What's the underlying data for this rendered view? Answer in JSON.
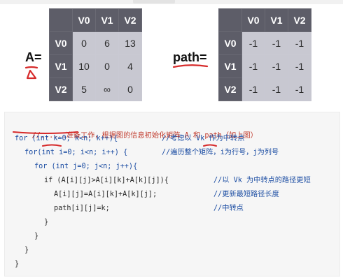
{
  "matrix_a": {
    "label": "A=",
    "columns": [
      "V0",
      "V1",
      "V2"
    ],
    "rows": [
      {
        "header": "V0",
        "cells": [
          "0",
          "6",
          "13"
        ]
      },
      {
        "header": "V1",
        "cells": [
          "10",
          "0",
          "4"
        ]
      },
      {
        "header": "V2",
        "cells": [
          "5",
          "∞",
          "0"
        ]
      }
    ]
  },
  "matrix_path": {
    "label": "path=",
    "columns": [
      "V0",
      "V1",
      "V2"
    ],
    "rows": [
      {
        "header": "V0",
        "cells": [
          "-1",
          "-1",
          "-1"
        ]
      },
      {
        "header": "V1",
        "cells": [
          "-1",
          "-1",
          "-1"
        ]
      },
      {
        "header": "V2",
        "cells": [
          "-1",
          "-1",
          "-1"
        ]
      }
    ]
  },
  "code": {
    "line1": "//......准备工作，根据图的信息初始化矩阵 A 和 path（如上图）",
    "line2_code": "for (int k=0; k<n; k++){",
    "line2_comment": "//考虑以 Vk 作为中转点",
    "line3_code": "for(int i=0; i<n; i++) {",
    "line3_comment": "//遍历整个矩阵，i为行号，j为列号",
    "line4_code": "for (int j=0; j<n; j++){",
    "line5_code": "if (A[i][j]>A[i][k]+A[k][j]){",
    "line5_comment": "//以 Vk 为中转点的路径更短",
    "line6_code": "A[i][j]=A[i][k]+A[k][j];",
    "line6_comment": "//更新最短路径长度",
    "line7_code": "path[i][j]=k;",
    "line7_comment": "//中转点",
    "close1": "}",
    "close2": "}",
    "close3": "}",
    "close4": "}"
  },
  "colors": {
    "header_bg": "#5d5d68",
    "cell_bg": "#c8c8d1",
    "annotation_red": "#d62a2a",
    "keyword_blue": "#1d4ea3"
  }
}
